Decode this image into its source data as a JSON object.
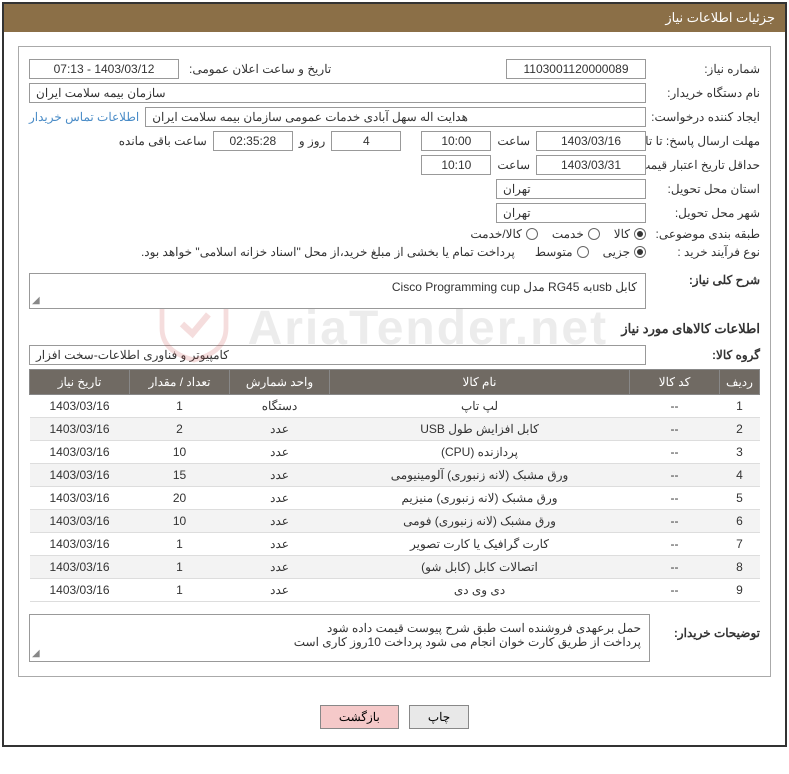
{
  "header": {
    "title": "جزئیات اطلاعات نیاز"
  },
  "form": {
    "need_no_label": "شماره نیاز:",
    "need_no": "1103001120000089",
    "announce_label": "تاریخ و ساعت اعلان عمومی:",
    "announce_val": "1403/03/12 - 07:13",
    "buyer_org_label": "نام دستگاه خریدار:",
    "buyer_org": "سازمان بیمه سلامت ایران",
    "requester_label": "ایجاد کننده درخواست:",
    "requester": "هدایت اله سهل آبادی خدمات عمومی سازمان بیمه سلامت ایران",
    "contact_link": "اطلاعات تماس خریدار",
    "deadline_label": "مهلت ارسال پاسخ: تا تاریخ:",
    "deadline_date": "1403/03/16",
    "time_label": "ساعت",
    "deadline_time": "10:00",
    "days_val": "4",
    "days_and": "روز و",
    "countdown": "02:35:28",
    "remaining": "ساعت باقی مانده",
    "validity_label": "حداقل تاریخ اعتبار قیمت: تا تاریخ:",
    "validity_date": "1403/03/31",
    "validity_time": "10:10",
    "province_label": "استان محل تحویل:",
    "province": "تهران",
    "city_label": "شهر محل تحویل:",
    "city": "تهران",
    "category_label": "طبقه بندی موضوعی:",
    "cat_goods": "کالا",
    "cat_service": "خدمت",
    "cat_goods_service": "کالا/خدمت",
    "process_label": "نوع فرآیند خرید :",
    "proc_partial": "جزیی",
    "proc_medium": "متوسط",
    "payment_note": "پرداخت تمام یا بخشی از مبلغ خرید،از محل \"اسناد خزانه اسلامی\" خواهد بود.",
    "summary_label": "شرح کلی نیاز:",
    "summary": "کابل usbبه RG45 مدل Cisco Programming cup",
    "section_title": "اطلاعات کالاهای مورد نیاز",
    "group_label": "گروه کالا:",
    "group_val": "کامپیوتر و فناوری اطلاعات-سخت افزار",
    "notes_label": "توضیحات خریدار:",
    "notes_line1": "حمل برعهدی فروشنده است طبق شرح پیوست قیمت داده شود",
    "notes_line2": "پرداخت از طریق کارت خوان انجام می شود پرداخت 10روز کاری است"
  },
  "table": {
    "headers": {
      "row": "ردیف",
      "code": "کد کالا",
      "name": "نام کالا",
      "unit": "واحد شمارش",
      "qty": "تعداد / مقدار",
      "date": "تاریخ نیاز"
    },
    "rows": [
      {
        "n": "1",
        "code": "--",
        "name": "لپ تاپ",
        "unit": "دستگاه",
        "qty": "1",
        "date": "1403/03/16"
      },
      {
        "n": "2",
        "code": "--",
        "name": "کابل افزایش طول USB",
        "unit": "عدد",
        "qty": "2",
        "date": "1403/03/16"
      },
      {
        "n": "3",
        "code": "--",
        "name": "پردازنده (CPU)",
        "unit": "عدد",
        "qty": "10",
        "date": "1403/03/16"
      },
      {
        "n": "4",
        "code": "--",
        "name": "ورق مشبک (لانه زنبوری) آلومینیومی",
        "unit": "عدد",
        "qty": "15",
        "date": "1403/03/16"
      },
      {
        "n": "5",
        "code": "--",
        "name": "ورق مشبک (لانه زنبوری) منیزیم",
        "unit": "عدد",
        "qty": "20",
        "date": "1403/03/16"
      },
      {
        "n": "6",
        "code": "--",
        "name": "ورق مشبک (لانه زنبوری) فومی",
        "unit": "عدد",
        "qty": "10",
        "date": "1403/03/16"
      },
      {
        "n": "7",
        "code": "--",
        "name": "کارت گرافیک یا کارت تصویر",
        "unit": "عدد",
        "qty": "1",
        "date": "1403/03/16"
      },
      {
        "n": "8",
        "code": "--",
        "name": "اتصالات کابل (کابل شو)",
        "unit": "عدد",
        "qty": "1",
        "date": "1403/03/16"
      },
      {
        "n": "9",
        "code": "--",
        "name": "دی وی دی",
        "unit": "عدد",
        "qty": "1",
        "date": "1403/03/16"
      }
    ]
  },
  "buttons": {
    "print": "چاپ",
    "back": "بازگشت"
  },
  "watermark": "AriaTender.net"
}
